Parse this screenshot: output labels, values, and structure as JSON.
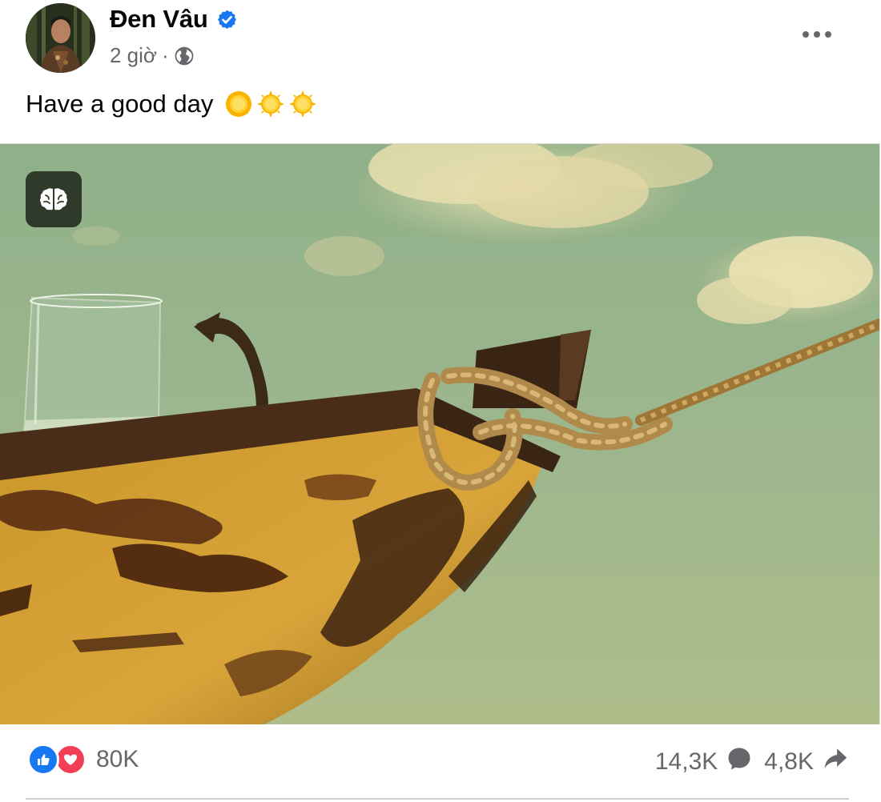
{
  "post": {
    "author": "Đen Vâu",
    "time": "2 giờ",
    "time_separator": "·",
    "caption": "Have a good day"
  },
  "footer": {
    "reaction_count": "80K",
    "comment_count": "14,3K",
    "share_count": "4,8K"
  },
  "icons": {
    "verified": "verified-badge-icon",
    "audience": "globe-icon",
    "more": "more-options-icon",
    "caption_emoji": [
      "sun-emoji",
      "sun-emoji",
      "sun-emoji"
    ],
    "photo_overlay": "brain-icon",
    "reactions": [
      "like-icon",
      "love-icon"
    ],
    "comment": "comment-icon",
    "share": "share-icon"
  },
  "colors": {
    "accent": "#1877f2",
    "love": "#f33e58",
    "secondary_text": "#65676b"
  }
}
